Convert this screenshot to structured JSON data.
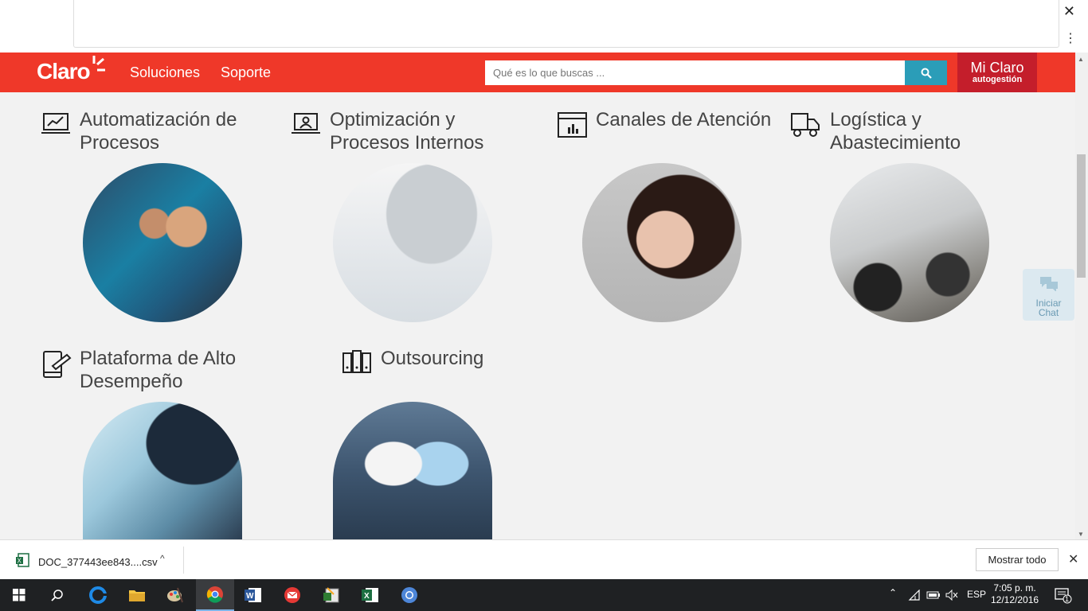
{
  "header": {
    "logo": "Claro",
    "nav": [
      "Soluciones",
      "Soporte"
    ],
    "search_placeholder": "Qué es lo que buscas ...",
    "mi_claro": "Mi Claro",
    "autogestion": "autogestión"
  },
  "categories": [
    {
      "title_line1": "Automatización de",
      "title_line2": "Procesos",
      "icon": "chart-monitor-icon"
    },
    {
      "title_line1": "Optimización y",
      "title_line2": "Procesos Internos",
      "icon": "video-conference-icon"
    },
    {
      "title_line1": "Canales de Atención",
      "title_line2": "",
      "icon": "dashboard-icon"
    },
    {
      "title_line1": "Logística y",
      "title_line2": "Abastecimiento",
      "icon": "truck-icon"
    },
    {
      "title_line1": "Plataforma de Alto",
      "title_line2": "Desempeño",
      "icon": "tablet-pen-icon"
    },
    {
      "title_line1": "Outsourcing",
      "title_line2": "",
      "icon": "server-icon"
    }
  ],
  "chat": {
    "line1": "Iniciar",
    "line2": "Chat"
  },
  "downloads": {
    "file_name": "DOC_377443ee843....csv",
    "show_all": "Mostrar todo"
  },
  "taskbar": {
    "language": "ESP",
    "time": "7:05 p. m.",
    "date": "12/12/2016",
    "notifications": "1"
  },
  "colors": {
    "brand_red": "#ef3829",
    "mi_claro_red": "#c41e2b",
    "search_button": "#2b9db8"
  }
}
